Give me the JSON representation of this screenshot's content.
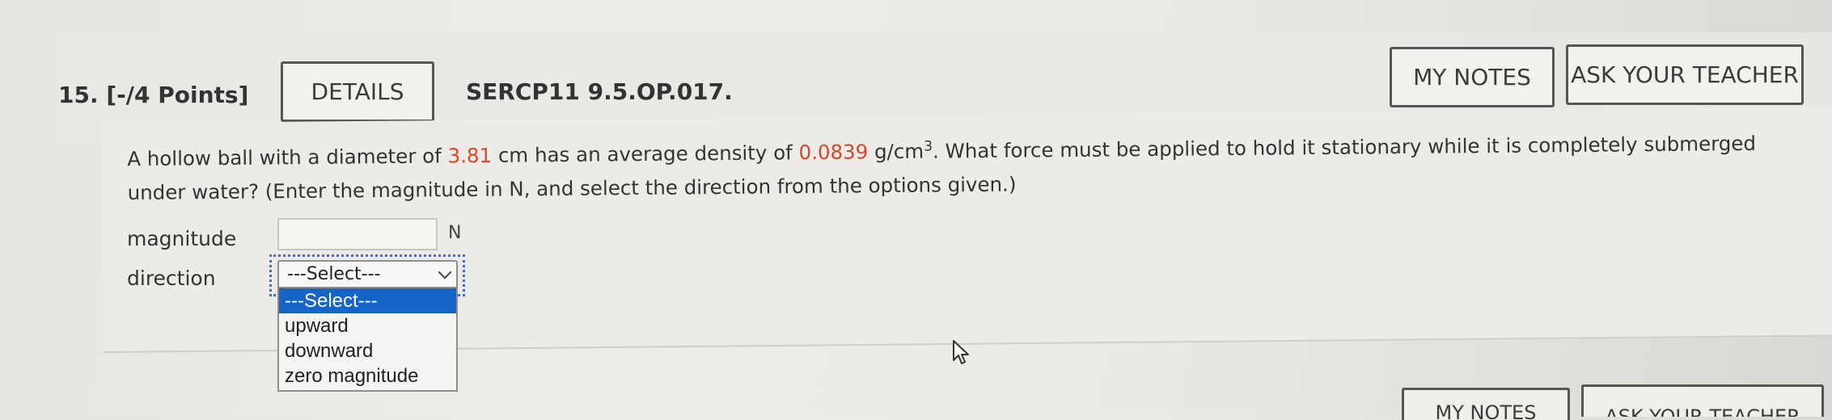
{
  "question": {
    "number_label": "15.",
    "points_label": "[-/4 Points]",
    "details_label": "DETAILS",
    "code": "SERCP11 9.5.OP.017.",
    "my_notes_label": "MY NOTES",
    "ask_teacher_label": "ASK YOUR TEACHER"
  },
  "prompt": {
    "part1": "A hollow ball with a diameter of ",
    "diameter_value": "3.81",
    "part2": " cm has an average density of ",
    "density_value": "0.0839",
    "part3": " g/cm",
    "exponent": "3",
    "part4": ". What force must be applied to hold it stationary while it is completely submerged under water? (Enter the magnitude in N, and select the direction from the options given.)"
  },
  "form": {
    "magnitude_label": "magnitude",
    "magnitude_value": "",
    "magnitude_unit": "N",
    "direction_label": "direction",
    "direction_selected": "---Select---",
    "direction_options": [
      "---Select---",
      "upward",
      "downward",
      "zero magnitude"
    ]
  },
  "next_question": {
    "notes_label": "MY NOTES",
    "ask_label": "ASK YOUR TEACHER"
  },
  "colors": {
    "highlight": "#d9472b",
    "selected_option_bg": "#1565c8",
    "focus_ring": "#4a6bc0"
  },
  "icons": [
    "mouse-cursor-icon",
    "chevron-down-icon"
  ]
}
